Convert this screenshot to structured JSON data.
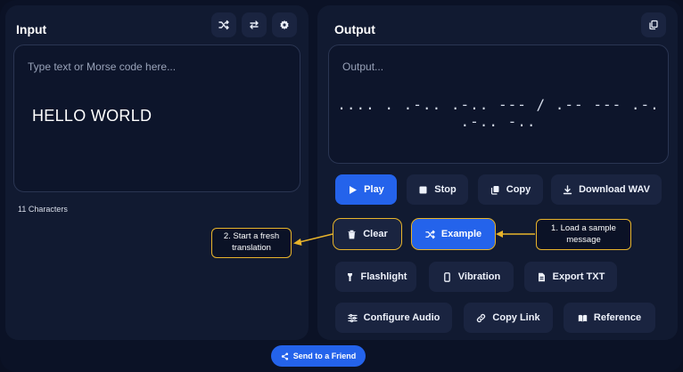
{
  "input_panel": {
    "title": "Input",
    "placeholder": "Type text or Morse code here...",
    "value": "HELLO WORLD",
    "char_count": "11 Characters",
    "icons": [
      "shuffle-icon",
      "swap-icon",
      "gear-icon"
    ]
  },
  "output_panel": {
    "title": "Output",
    "placeholder": "Output...",
    "morse": ".... . .-.. .-.. --- / .-- --- .-. .-.. -..",
    "copy_icon": "copy-icon"
  },
  "buttons": {
    "play": "Play",
    "stop": "Stop",
    "copy": "Copy",
    "download_wav": "Download WAV",
    "clear": "Clear",
    "example": "Example",
    "flashlight": "Flashlight",
    "vibration": "Vibration",
    "export_txt": "Export TXT",
    "configure_audio": "Configure Audio",
    "copy_link": "Copy Link",
    "reference": "Reference"
  },
  "callouts": {
    "fresh_translation": "2. Start a fresh translation",
    "sample_message": "1. Load a sample message"
  },
  "footer": {
    "send_to_friend": "Send to a Friend"
  },
  "colors": {
    "accent": "#2463eb",
    "callout": "#e8b42b",
    "panel": "#111a31",
    "background": "#0b1226"
  }
}
